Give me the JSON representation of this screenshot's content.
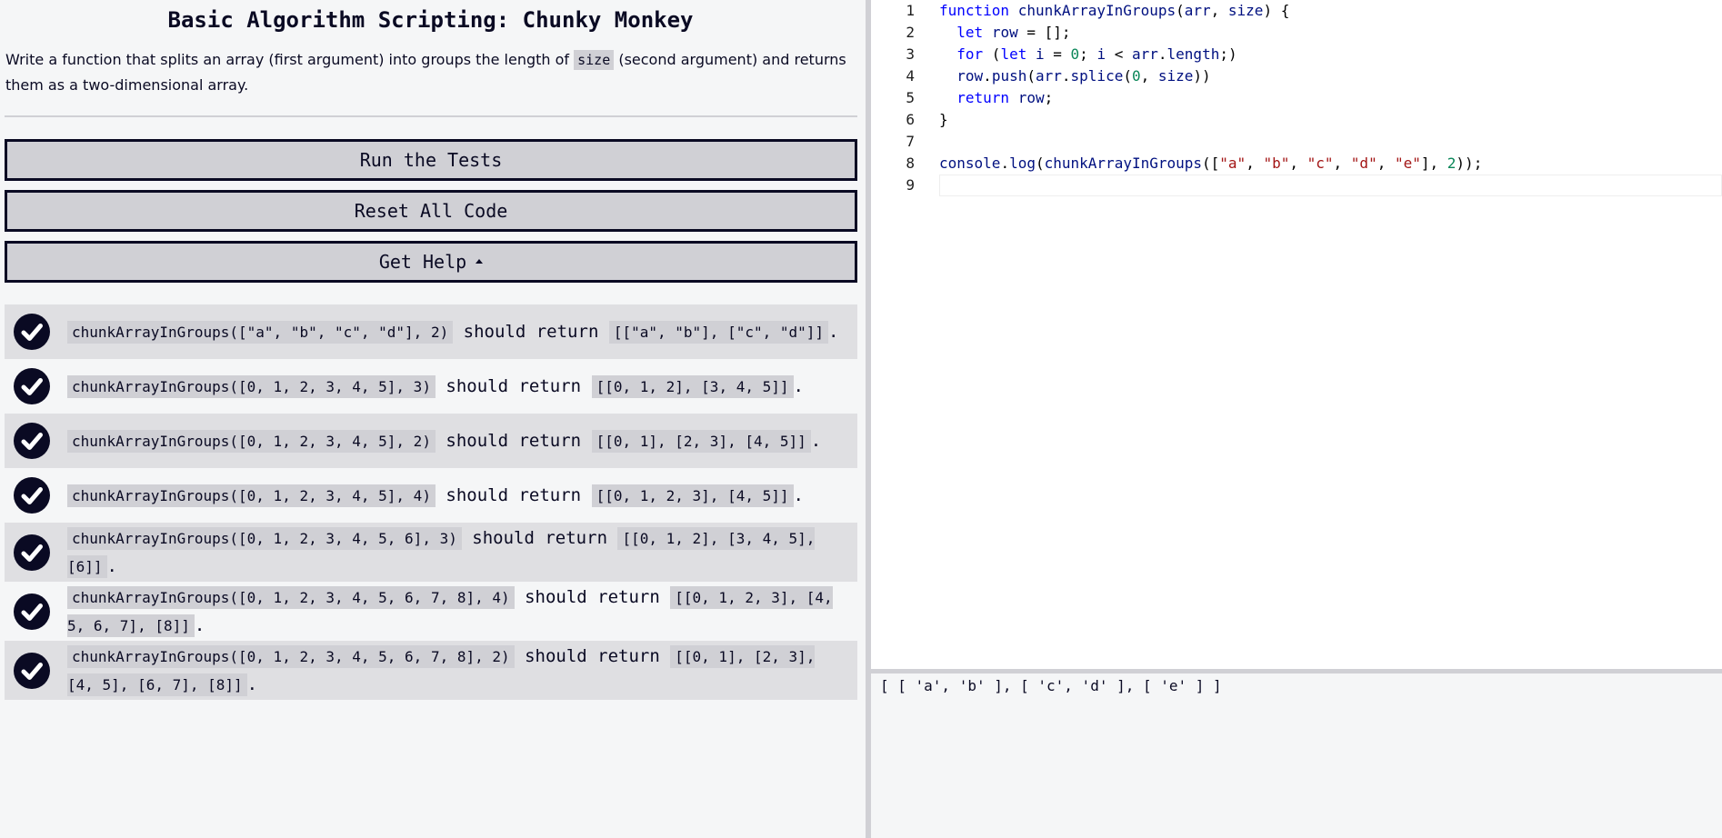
{
  "challenge": {
    "title": "Basic Algorithm Scripting: Chunky Monkey",
    "description_before": "Write a function that splits an array (first argument) into groups the length of ",
    "description_code": "size",
    "description_after": " (second argument) and returns them as a two-dimensional array."
  },
  "buttons": {
    "run_tests": "Run the Tests",
    "reset_code": "Reset All Code",
    "get_help": "Get Help"
  },
  "tests": [
    {
      "call": "chunkArrayInGroups([\"a\", \"b\", \"c\", \"d\"], 2)",
      "verb": "should return",
      "expected": "[[\"a\", \"b\"], [\"c\", \"d\"]]",
      "status": "passed"
    },
    {
      "call": "chunkArrayInGroups([0, 1, 2, 3, 4, 5], 3)",
      "verb": "should return",
      "expected": "[[0, 1, 2], [3, 4, 5]]",
      "status": "passed"
    },
    {
      "call": "chunkArrayInGroups([0, 1, 2, 3, 4, 5], 2)",
      "verb": "should return",
      "expected": "[[0, 1], [2, 3], [4, 5]]",
      "status": "passed"
    },
    {
      "call": "chunkArrayInGroups([0, 1, 2, 3, 4, 5], 4)",
      "verb": "should return",
      "expected": "[[0, 1, 2, 3], [4, 5]]",
      "status": "passed"
    },
    {
      "call": "chunkArrayInGroups([0, 1, 2, 3, 4, 5, 6], 3)",
      "verb": "should return",
      "expected": "[[0, 1, 2], [3, 4, 5], [6]]",
      "status": "passed"
    },
    {
      "call": "chunkArrayInGroups([0, 1, 2, 3, 4, 5, 6, 7, 8], 4)",
      "verb": "should return",
      "expected": "[[0, 1, 2, 3], [4, 5, 6, 7], [8]]",
      "status": "passed"
    },
    {
      "call": "chunkArrayInGroups([0, 1, 2, 3, 4, 5, 6, 7, 8], 2)",
      "verb": "should return",
      "expected": "[[0, 1], [2, 3], [4, 5], [6, 7], [8]]",
      "status": "passed"
    }
  ],
  "editor": {
    "line_numbers": [
      "1",
      "2",
      "3",
      "4",
      "5",
      "6",
      "7",
      "8",
      "9"
    ],
    "lines": [
      "function chunkArrayInGroups(arr, size) {",
      "  let row = [];",
      "  for (let i = 0; i < arr.length;)",
      "  row.push(arr.splice(0, size))",
      "  return row;",
      "}",
      "",
      "console.log(chunkArrayInGroups([\"a\", \"b\", \"c\", \"d\", \"e\"], 2));",
      ""
    ]
  },
  "console": {
    "output": "[ [ 'a', 'b' ], [ 'c', 'd' ], [ 'e' ] ]"
  },
  "colors": {
    "background": "#f5f6f7",
    "ink": "#0a0a23",
    "button_fill": "#d0d0d5",
    "test_row_shade": "#dfdfe2",
    "editor_keyword": "#0000ff",
    "editor_identifier": "#001080",
    "editor_number": "#098658",
    "editor_string": "#a31515"
  },
  "icons": {
    "test_status": "check-circle-icon",
    "help_toggle": "caret-up-icon"
  }
}
